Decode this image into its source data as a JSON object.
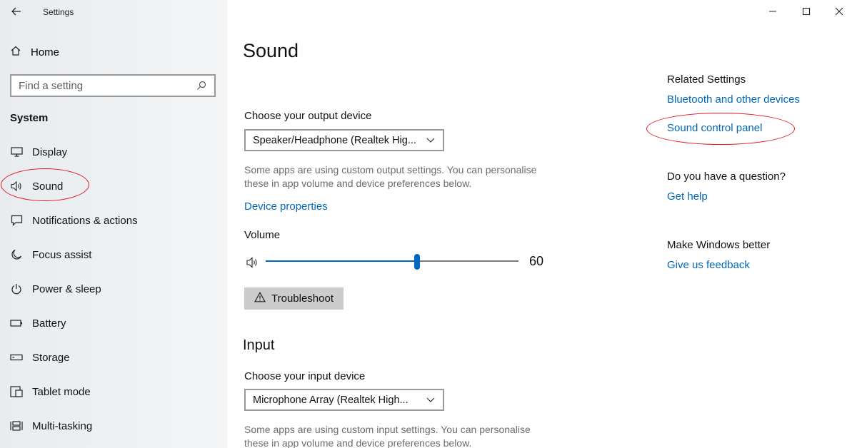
{
  "window": {
    "title": "Settings",
    "back_icon": "back-arrow-icon",
    "controls": [
      "minimize-icon",
      "maximize-icon",
      "close-icon"
    ]
  },
  "sidebar": {
    "home_label": "Home",
    "search_placeholder": "Find a setting",
    "section_label": "System",
    "items": [
      {
        "label": "Display",
        "icon": "display-icon"
      },
      {
        "label": "Sound",
        "icon": "speaker-icon"
      },
      {
        "label": "Notifications & actions",
        "icon": "notifications-icon"
      },
      {
        "label": "Focus assist",
        "icon": "moon-icon"
      },
      {
        "label": "Power & sleep",
        "icon": "power-icon"
      },
      {
        "label": "Battery",
        "icon": "battery-icon"
      },
      {
        "label": "Storage",
        "icon": "storage-icon"
      },
      {
        "label": "Tablet mode",
        "icon": "tablet-icon"
      },
      {
        "label": "Multi-tasking",
        "icon": "multitasking-icon"
      }
    ]
  },
  "main": {
    "title": "Sound",
    "output": {
      "label": "Choose your output device",
      "selected": "Speaker/Headphone (Realtek Hig...",
      "help_line1": "Some apps are using custom output settings. You can personalise",
      "help_line2": "these in app volume and device preferences below.",
      "device_properties_link": "Device properties",
      "volume_label": "Volume",
      "volume_value": "60",
      "volume_fraction": 0.6,
      "troubleshoot_label": "Troubleshoot"
    },
    "input": {
      "section_title": "Input",
      "label": "Choose your input device",
      "selected": "Microphone Array (Realtek High...",
      "help_line1": "Some apps are using custom input settings. You can personalise",
      "help_line2": "these in app volume and device preferences below."
    }
  },
  "related": {
    "heading": "Related Settings",
    "bluetooth_link": "Bluetooth and other devices",
    "sound_cp_link": "Sound control panel",
    "question_heading": "Do you have a question?",
    "help_link": "Get help",
    "better_heading": "Make Windows better",
    "feedback_link": "Give us feedback"
  },
  "colors": {
    "accent": "#0067c0",
    "link": "#0067b8",
    "annotation": "#e3151a"
  }
}
